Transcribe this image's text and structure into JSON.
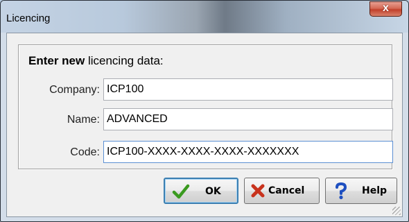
{
  "window": {
    "title": "Licencing",
    "close_label": "x"
  },
  "form": {
    "heading_bold": "Enter new",
    "heading_rest": " licencing data:",
    "company_label": "Company:",
    "company_value": "ICP100",
    "name_label": "Name:",
    "name_value": "ADVANCED",
    "code_label": "Code:",
    "code_value": "ICP100-XXXX-XXXX-XXXX-XXXXXXX"
  },
  "buttons": {
    "ok": "OK",
    "cancel": "Cancel",
    "help": "Help"
  },
  "icons": {
    "ok": "check-icon",
    "cancel": "x-icon",
    "help": "question-icon"
  },
  "colors": {
    "ok_icon": "#3a9a1f",
    "cancel_icon": "#c8321c",
    "help_icon": "#1e4fc0",
    "focus_border": "#5b8fd3"
  }
}
